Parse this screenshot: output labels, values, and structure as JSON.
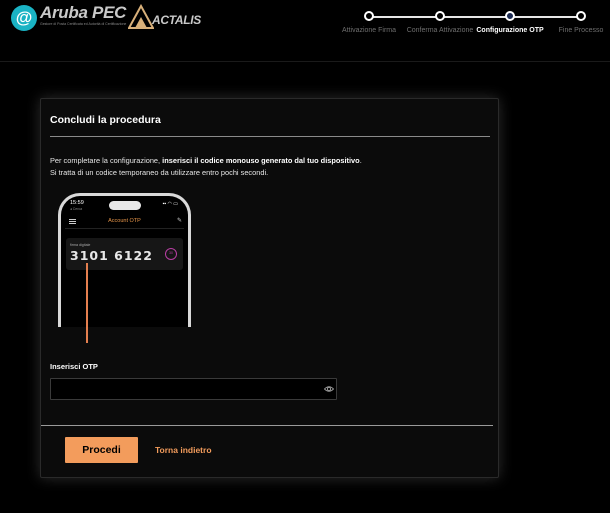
{
  "header": {
    "aruba_logo": {
      "mark": "@",
      "name": "Aruba PEC",
      "tagline": "Gestore di Posta Certificata ed Autorità di Certificazione",
      "color": "#1ab3c4"
    },
    "actalis_logo": {
      "name": "ACTALIS",
      "icon": "actalis-triangle-icon"
    }
  },
  "steps": [
    {
      "label": "Attivazione Firma",
      "state": "done"
    },
    {
      "label": "Conferma Attivazione",
      "state": "done"
    },
    {
      "label": "Configurazione OTP",
      "state": "active"
    },
    {
      "label": "Fine Processo",
      "state": "todo"
    }
  ],
  "card": {
    "title": "Concludi la procedura",
    "desc_prefix": "Per completare la configurazione, ",
    "desc_bold": "inserisci il codice monouso generato dal tuo dispositivo",
    "desc_suffix": ".",
    "desc_line2": "Si tratta di un codice temporaneo da utilizzare entro pochi secondi.",
    "phone": {
      "time": "15:59",
      "back_label": "◂ Cerca",
      "status": "▪▪ ◠ ▭",
      "app_title": "Account OTP",
      "otp_label": "firma digitale",
      "otp_code": "3101 6122",
      "timer": "30"
    },
    "otp_field": {
      "label": "Inserisci OTP",
      "value": "",
      "placeholder": ""
    },
    "primary_button": "Procedi",
    "secondary_link": "Torna indietro"
  },
  "colors": {
    "accent": "#f39c5c",
    "background": "#000000",
    "card": "#0b0b0b",
    "pointer": "#e47f4f",
    "timer": "#b83ea3"
  }
}
